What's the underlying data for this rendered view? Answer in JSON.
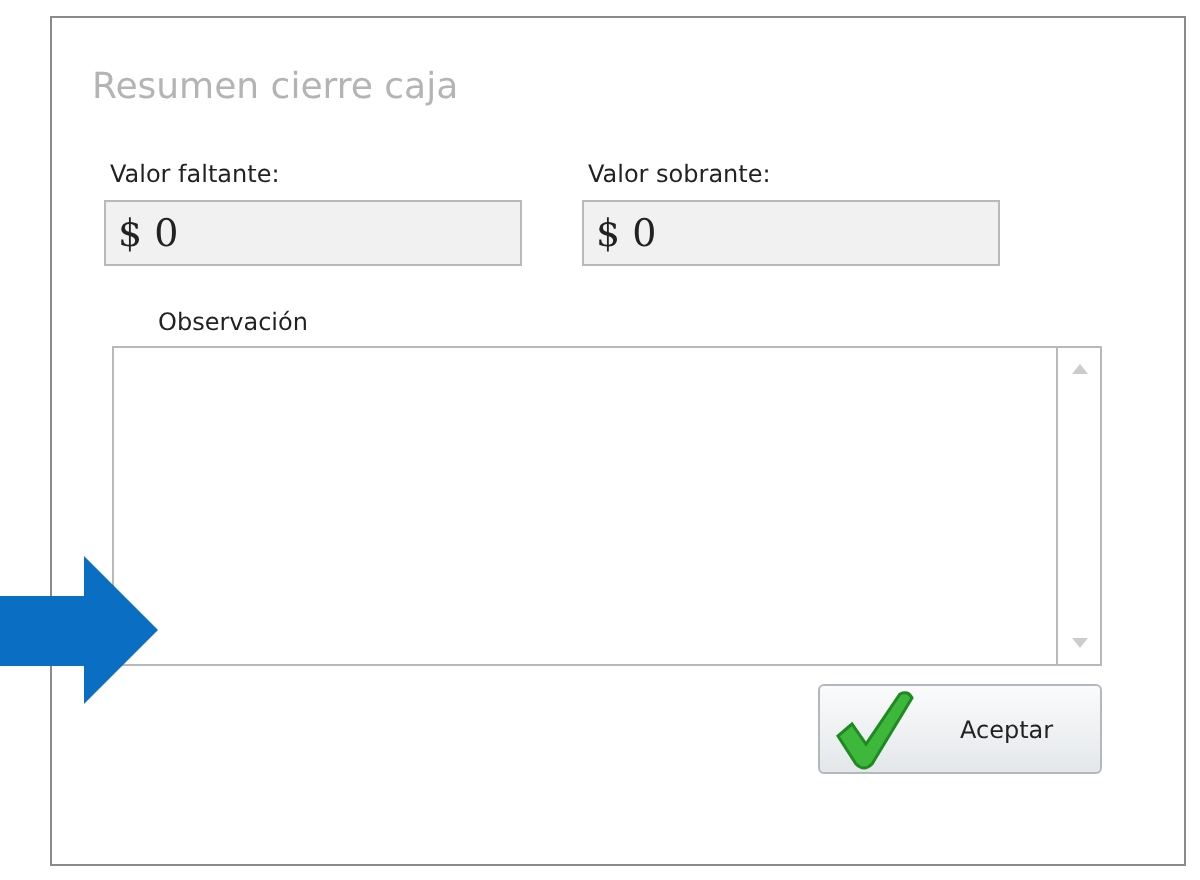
{
  "dialog": {
    "title": "Resumen cierre caja",
    "fields": [
      {
        "label": "Valor faltante:",
        "value": "$ 0"
      },
      {
        "label": "Valor sobrante:",
        "value": "$ 0"
      }
    ],
    "observation": {
      "label": "Observación"
    },
    "buttons": [
      {
        "label": "Aceptar",
        "kind": "accept"
      }
    ]
  }
}
